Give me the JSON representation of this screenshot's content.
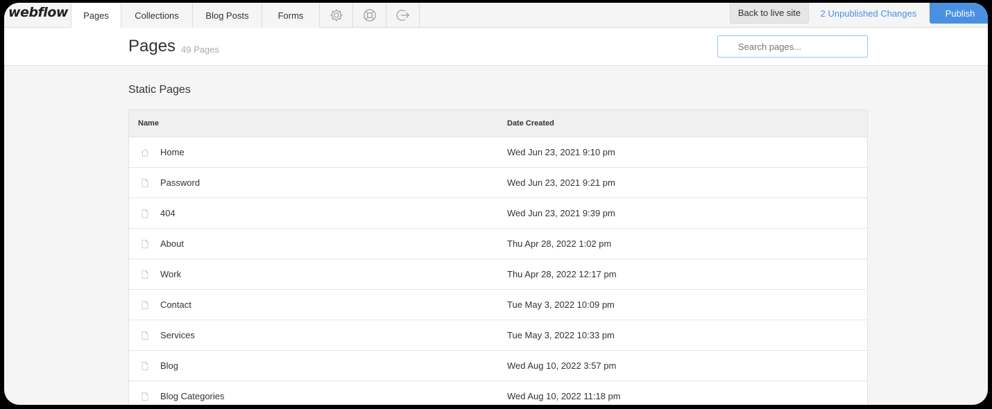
{
  "app": {
    "logo": "webflow"
  },
  "nav": {
    "tabs": [
      {
        "label": "Pages",
        "active": true
      },
      {
        "label": "Collections",
        "active": false
      },
      {
        "label": "Blog Posts",
        "active": false
      },
      {
        "label": "Forms",
        "active": false
      }
    ],
    "icons": [
      "gear-icon",
      "help-icon",
      "exit-icon"
    ],
    "back_label": "Back to live site",
    "unpublished_label": "2 Unpublished Changes",
    "publish_label": "Publish",
    "accent": "#4a90e2"
  },
  "header": {
    "title": "Pages",
    "count": "49 Pages",
    "search_placeholder": "Search pages..."
  },
  "section": {
    "title": "Static Pages",
    "columns": [
      "Name",
      "Date Created"
    ],
    "rows": [
      {
        "icon": "home-icon",
        "name": "Home",
        "date": "Wed Jun 23, 2021 9:10 pm"
      },
      {
        "icon": "page-icon",
        "name": "Password",
        "date": "Wed Jun 23, 2021 9:21 pm"
      },
      {
        "icon": "page-icon",
        "name": "404",
        "date": "Wed Jun 23, 2021 9:39 pm"
      },
      {
        "icon": "page-icon",
        "name": "About",
        "date": "Thu Apr 28, 2022 1:02 pm"
      },
      {
        "icon": "page-icon",
        "name": "Work",
        "date": "Thu Apr 28, 2022 12:17 pm"
      },
      {
        "icon": "page-icon",
        "name": "Contact",
        "date": "Tue May 3, 2022 10:09 pm"
      },
      {
        "icon": "page-icon",
        "name": "Services",
        "date": "Tue May 3, 2022 10:33 pm"
      },
      {
        "icon": "page-icon",
        "name": "Blog",
        "date": "Wed Aug 10, 2022 3:57 pm"
      },
      {
        "icon": "page-icon",
        "name": "Blog Categories",
        "date": "Wed Aug 10, 2022 11:18 pm"
      }
    ]
  }
}
